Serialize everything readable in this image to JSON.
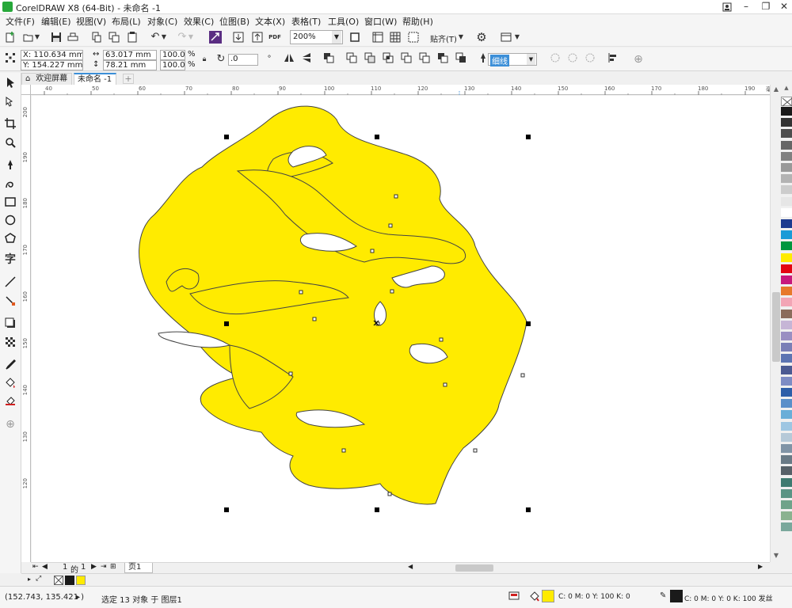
{
  "window": {
    "title": "CorelDRAW X8 (64-Bit) - 未命名 -1",
    "controls": {
      "help_icon": "person-icon",
      "minimize": "–",
      "restore": "❐",
      "close": "✕"
    }
  },
  "menu": [
    "文件(F)",
    "编辑(E)",
    "视图(V)",
    "布局(L)",
    "对象(C)",
    "效果(C)",
    "位图(B)",
    "文本(X)",
    "表格(T)",
    "工具(O)",
    "窗口(W)",
    "帮助(H)"
  ],
  "toolbar": {
    "zoom_value": "200%",
    "snap_label": "贴齐(T)",
    "pdf_label": "PDF"
  },
  "property_bar": {
    "x": "X: 110.634 mm",
    "y": "Y: 154.227 mm",
    "width": "63.017 mm",
    "height": "78.21 mm",
    "scale_x": "100.0",
    "scale_y": "100.0",
    "percent": "%",
    "rotation": ".0",
    "outline_width": "细线"
  },
  "tabs": [
    {
      "label": "欢迎屏幕"
    },
    {
      "label": "未命名 -1"
    }
  ],
  "rulers": {
    "horizontal": [
      "40",
      "50",
      "60",
      "70",
      "80",
      "90",
      "100",
      "110",
      "120",
      "130",
      "140",
      "150",
      "160",
      "170",
      "180",
      "190"
    ],
    "unit": "毫米",
    "vertical": [
      "200",
      "190",
      "180",
      "170",
      "160",
      "150",
      "140",
      "130",
      "120"
    ]
  },
  "page_nav": {
    "current": "1",
    "of_label": "的",
    "total": "1",
    "page_tab": "页1"
  },
  "status": {
    "coords": "(152.743, 135.421 )",
    "arrow": "▸",
    "selection": "选定 13 对象 于 图层1",
    "fill_info": "C: 0 M: 0 Y: 100 K: 0",
    "outline_info": "C: 0 M: 0 Y: 0 K: 100  发丝"
  },
  "colors": {
    "accent_yellow": "#ffeb00",
    "outline": "#444444"
  },
  "palette": [
    "#1a1a1a",
    "#333333",
    "#4d4d4d",
    "#666666",
    "#808080",
    "#999999",
    "#b3b3b3",
    "#cccccc",
    "#e6e6e6",
    "#ffffff",
    "#1d3a8f",
    "#1a9bd7",
    "#00963f",
    "#ffeb00",
    "#e30613",
    "#c7197d",
    "#e7792b",
    "#f2a5b5",
    "#8b6c5c",
    "#c6b5d6",
    "#9a8fc2",
    "#7a7fb6",
    "#5c74b2",
    "#4b5a92",
    "#7d8cc4",
    "#2d5ea8",
    "#5a8fc9",
    "#6aaed8",
    "#9ec6e2",
    "#b6c9d8",
    "#8094a6",
    "#697a86",
    "#566068",
    "#3e7a70",
    "#5b9485",
    "#6fa38a",
    "#8ab28f",
    "#7aa89c"
  ]
}
